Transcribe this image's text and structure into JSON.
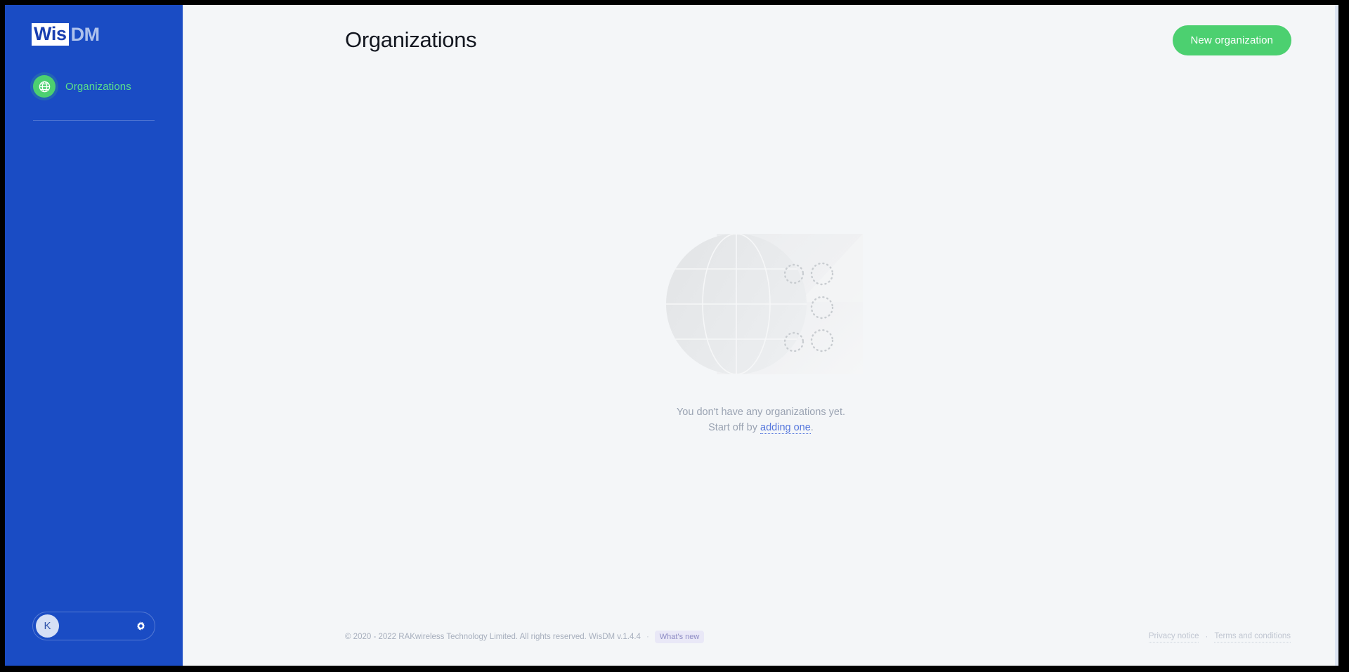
{
  "app": {
    "logo_primary": "Wis",
    "logo_secondary": "DM",
    "brand_blue": "#1a4cc4",
    "accent_green": "#4cd070",
    "link_blue": "#5577dd"
  },
  "sidebar": {
    "items": [
      {
        "label": "Organizations",
        "icon": "globe-icon",
        "active": true
      }
    ],
    "user": {
      "avatar_initial": "K",
      "settings_icon": "gear-icon"
    }
  },
  "header": {
    "title": "Organizations",
    "new_organization_label": "New organization"
  },
  "empty_state": {
    "illustration": "globe-illustration",
    "line1": "You don't have any organizations yet.",
    "line2_prefix": "Start off by ",
    "link_label": "adding one",
    "line2_suffix": "."
  },
  "footer": {
    "copyright": "© 2020 - 2022 RAKwireless Technology Limited. All rights reserved. WisDM v.1.4.4",
    "separator": "·",
    "whats_new_label": "What's new",
    "privacy_label": "Privacy notice",
    "terms_separator": "·",
    "terms_label": "Terms and conditions"
  }
}
